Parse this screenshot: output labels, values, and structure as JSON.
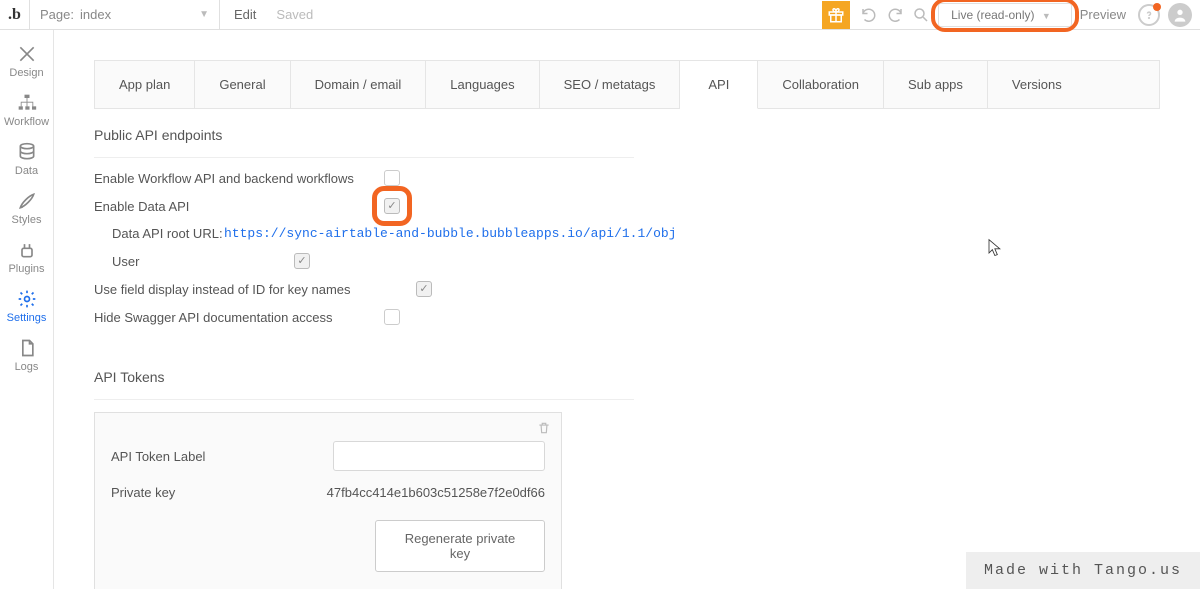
{
  "topbar": {
    "page_label_prefix": "Page:",
    "page_name": "index",
    "edit": "Edit",
    "saved": "Saved",
    "live_label": "Live (read-only)",
    "preview": "Preview"
  },
  "sidenav": {
    "design": "Design",
    "workflow": "Workflow",
    "data": "Data",
    "styles": "Styles",
    "plugins": "Plugins",
    "settings": "Settings",
    "logs": "Logs"
  },
  "tabs": {
    "app_plan": "App plan",
    "general": "General",
    "domain_email": "Domain / email",
    "languages": "Languages",
    "seo": "SEO / metatags",
    "api": "API",
    "collaboration": "Collaboration",
    "sub_apps": "Sub apps",
    "versions": "Versions"
  },
  "sections": {
    "public_api": "Public API endpoints",
    "api_tokens": "API Tokens"
  },
  "settings": {
    "enable_workflow_api": "Enable Workflow API and backend workflows",
    "enable_data_api": "Enable Data API",
    "data_api_root_label": "Data API root URL:",
    "data_api_root_value": "https://sync-airtable-and-bubble.bubbleapps.io/api/1.1/obj",
    "user_type": "User",
    "use_field_display": "Use field display instead of ID for key names",
    "hide_swagger": "Hide Swagger API documentation access"
  },
  "token_box": {
    "api_token_label": "API Token Label",
    "private_key_label": "Private key",
    "private_key_value": "47fb4cc414e1b603c51258e7f2e0df66",
    "regenerate": "Regenerate private key"
  },
  "watermark": "Made with Tango.us"
}
